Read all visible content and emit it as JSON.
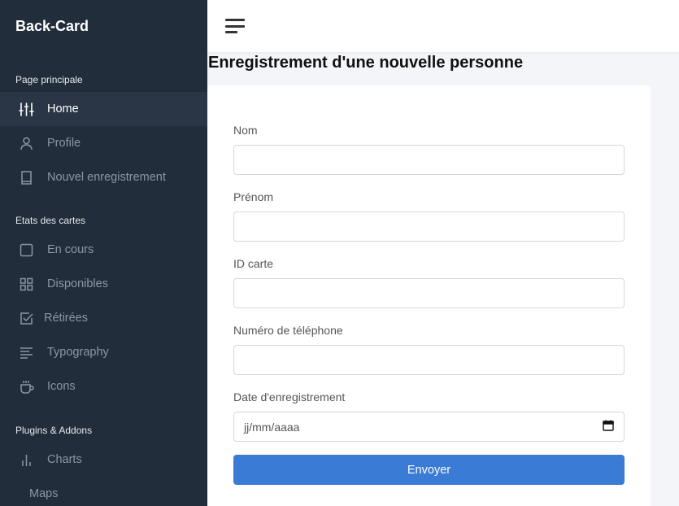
{
  "brand": "Back-Card",
  "sidebar": {
    "sections": [
      {
        "title": "Page principale"
      },
      {
        "title": "Etats des cartes"
      },
      {
        "title": "Plugins & Addons"
      }
    ],
    "items": [
      {
        "label": "Home",
        "icon": "sliders-icon"
      },
      {
        "label": "Profile",
        "icon": "user-icon"
      },
      {
        "label": "Nouvel enregistrement",
        "icon": "book-icon"
      },
      {
        "label": "En cours",
        "icon": "square-icon"
      },
      {
        "label": "Disponibles",
        "icon": "grid-icon"
      },
      {
        "label": "Rétirées",
        "icon": "check-square-icon"
      },
      {
        "label": "Typography",
        "icon": "align-left-icon"
      },
      {
        "label": "Icons",
        "icon": "coffee-icon"
      },
      {
        "label": "Charts",
        "icon": "bar-chart-icon"
      },
      {
        "label": "Maps",
        "icon": ""
      }
    ]
  },
  "page": {
    "title": "Enregistrement d'une nouvelle personne"
  },
  "form": {
    "fields": [
      {
        "label": "Nom",
        "value": ""
      },
      {
        "label": "Prénom",
        "value": ""
      },
      {
        "label": "ID carte",
        "value": ""
      },
      {
        "label": "Numéro de téléphone",
        "value": ""
      },
      {
        "label": "Date d'enregistrement",
        "placeholder": "jj/mm/aaaa"
      }
    ],
    "submit_label": "Envoyer"
  },
  "colors": {
    "sidebar_bg": "#222d3b",
    "accent": "#3a7bd5"
  }
}
